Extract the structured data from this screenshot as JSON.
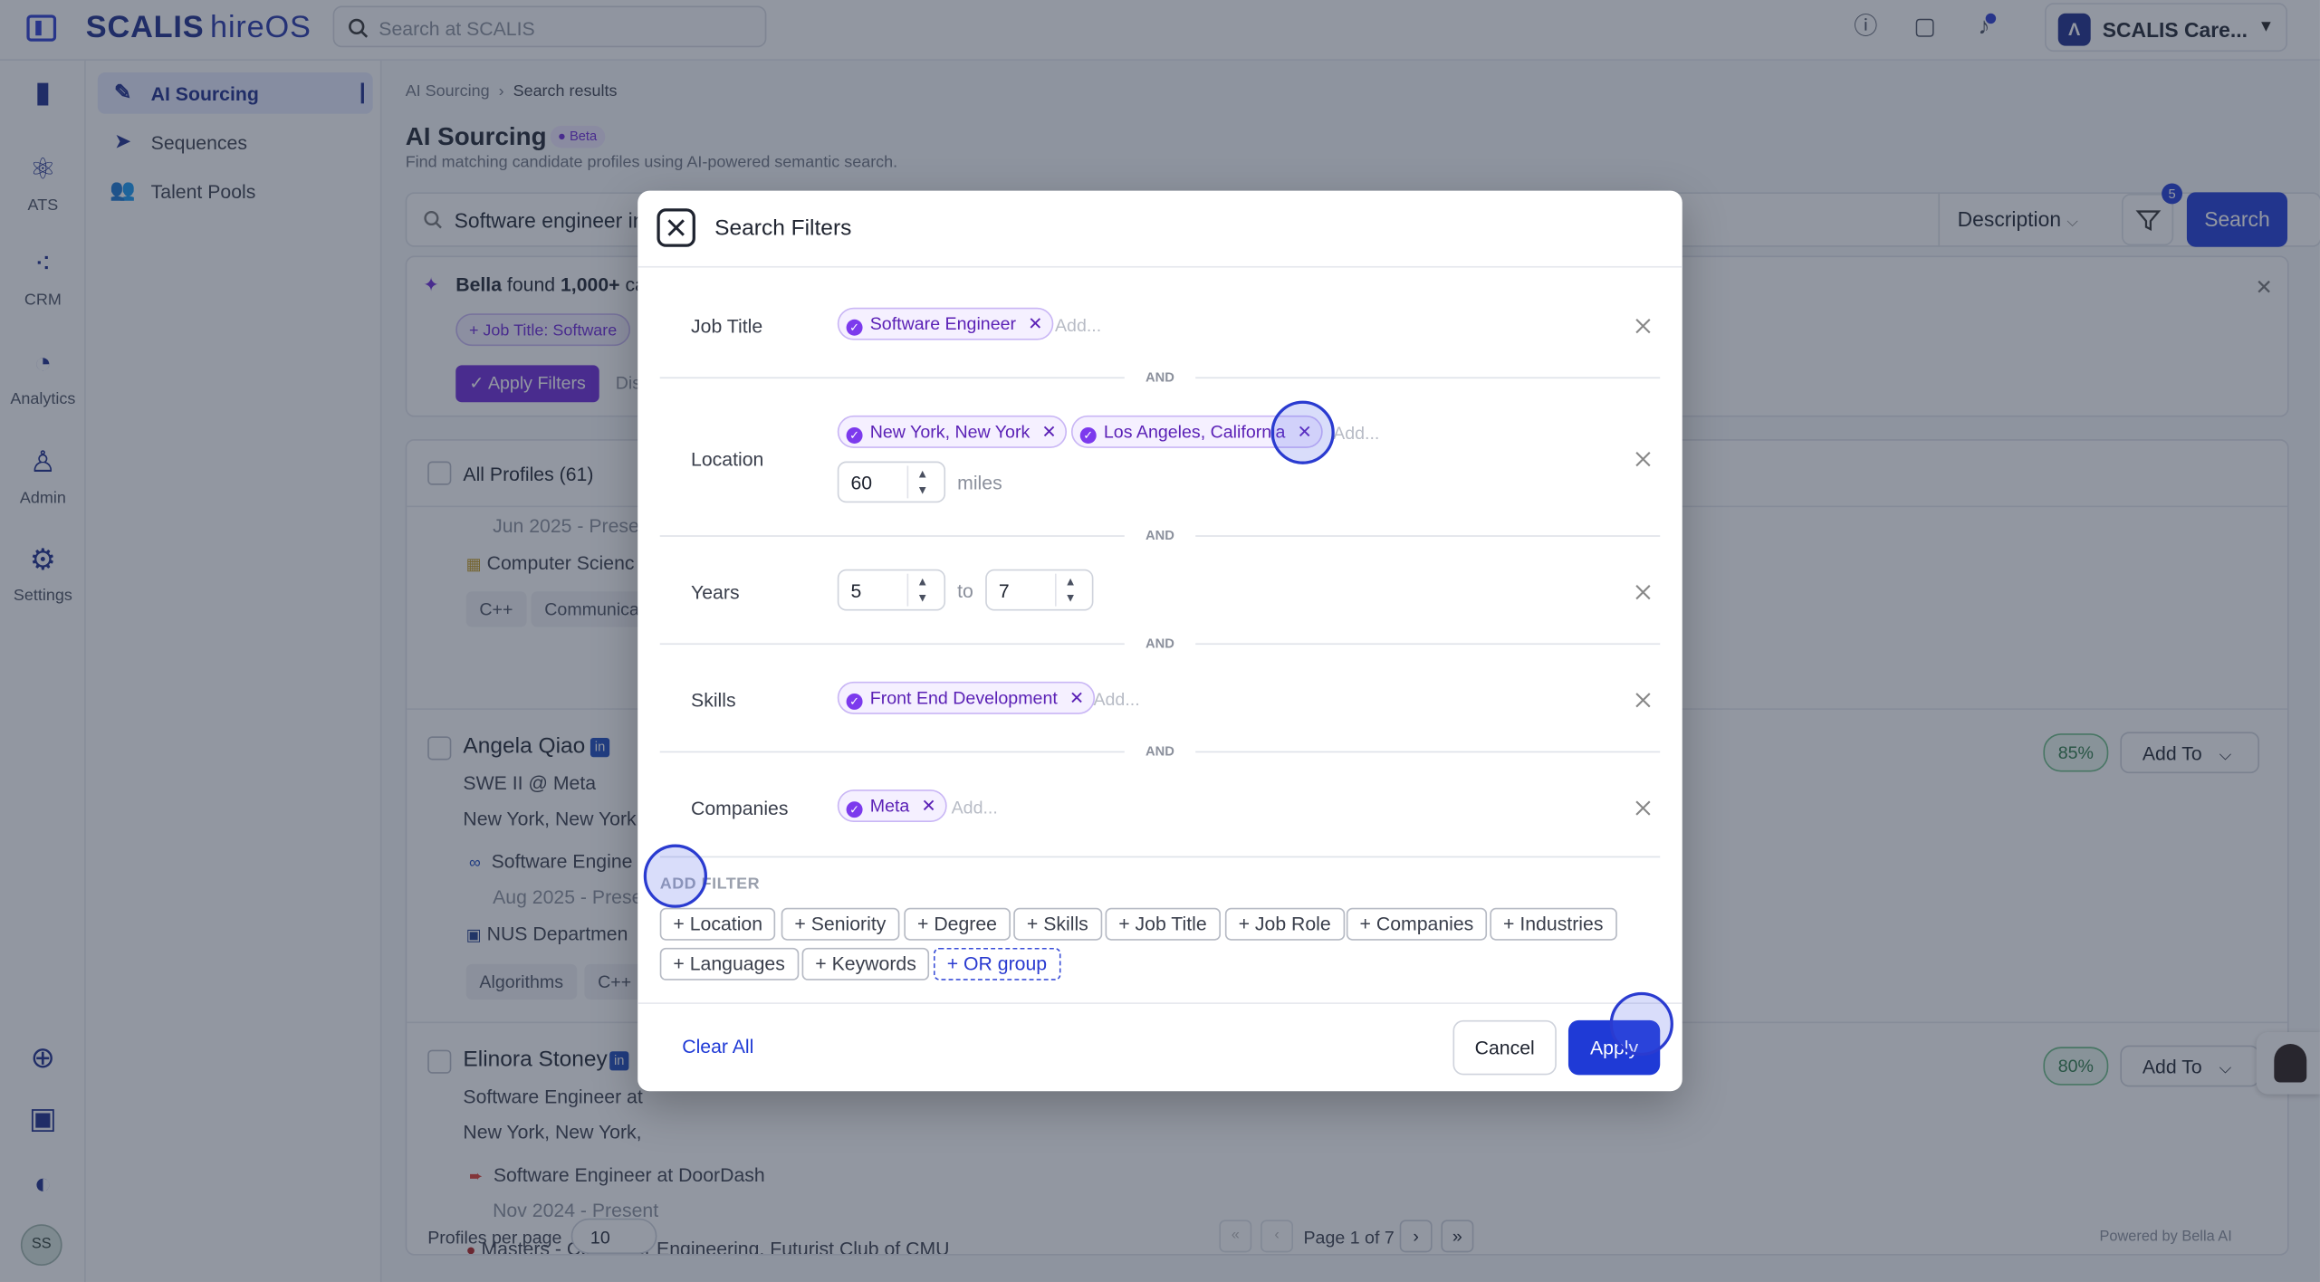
{
  "app": {
    "logo": "SCALIS",
    "logo_sub": "hireOS",
    "search_placeholder": "Search at SCALIS",
    "org_name": "SCALIS Care...",
    "org_badge": "Λ"
  },
  "rail": [
    {
      "label": "",
      "icon": "bookmark-icon"
    },
    {
      "label": "ATS",
      "icon": "atom-icon"
    },
    {
      "label": "CRM",
      "icon": "crm-icon"
    },
    {
      "label": "Analytics",
      "icon": "chart-pie-icon"
    },
    {
      "label": "Admin",
      "icon": "admin-icon"
    },
    {
      "label": "Settings",
      "icon": "settings-icon"
    }
  ],
  "avatar": "SS",
  "subnav": [
    {
      "label": "AI Sourcing",
      "icon": "pencil-icon"
    },
    {
      "label": "Sequences",
      "icon": "send-icon"
    },
    {
      "label": "Talent Pools",
      "icon": "users-icon"
    }
  ],
  "page": {
    "breadcrumb": [
      "AI Sourcing",
      "Search results"
    ],
    "title": "AI Sourcing",
    "badge": "Beta",
    "description": "Find matching candidate profiles using AI-powered semantic search.",
    "query": "Software engineer in",
    "mode": "Description",
    "filter_count": "5",
    "search_label": "Search"
  },
  "bella": {
    "name": "Bella",
    "text": " found ",
    "count": "1,000+",
    "tail": " ca",
    "chip": "+ Job Title: Software",
    "apply": "✓ Apply Filters",
    "dismiss": "Dis"
  },
  "list": {
    "all_profiles": "All Profiles (61)",
    "prev_date": "Jun 2025 - Prese",
    "prev_edu": "Computer Scienc",
    "prev_tags": [
      "C++",
      "Communica"
    ],
    "people": [
      {
        "name": "Angela Qiao",
        "title": "SWE II @ Meta",
        "loc": "New York, New York,",
        "job": "Software Engine",
        "date": "Aug 2025 - Prese",
        "edu": "NUS Departmen",
        "tags": [
          "Algorithms",
          "C++"
        ],
        "score": "85%",
        "add": "Add To"
      },
      {
        "name": "Elinora Stoney",
        "title": "Software Engineer at",
        "loc": "New York, New York,",
        "job": "Software Engineer at DoorDash",
        "date": "Nov 2024 - Present",
        "edu": "Masters - Computer Engineering, Futurist Club of CMU",
        "score": "80%",
        "add": "Add To"
      }
    ]
  },
  "footer": {
    "per_page_label": "Profiles per page",
    "per_page": "10",
    "pagination": "Page 1 of 7",
    "powered": "Powered by Bella AI"
  },
  "modal": {
    "title": "Search Filters",
    "and": "AND",
    "filters": {
      "job_title": {
        "label": "Job Title",
        "chips": [
          "Software Engineer"
        ],
        "placeholder": "Add..."
      },
      "location": {
        "label": "Location",
        "chips": [
          "New York, New York",
          "Los Angeles, California"
        ],
        "placeholder": "Add...",
        "radius": "60",
        "unit": "miles"
      },
      "years": {
        "label": "Years",
        "from": "5",
        "to_label": "to",
        "to": "7"
      },
      "skills": {
        "label": "Skills",
        "chips": [
          "Front End Development"
        ],
        "placeholder": "Add..."
      },
      "companies": {
        "label": "Companies",
        "chips": [
          "Meta"
        ],
        "placeholder": "Add..."
      }
    },
    "add_filter_label": "ADD FILTER",
    "add_filter_options": [
      "+ Location",
      "+ Seniority",
      "+ Degree",
      "+ Skills",
      "+ Job Title",
      "+ Job Role",
      "+ Companies",
      "+ Industries",
      "+ Languages",
      "+ Keywords",
      "+ OR group"
    ],
    "clear_all": "Clear All",
    "cancel": "Cancel",
    "apply": "Apply"
  }
}
